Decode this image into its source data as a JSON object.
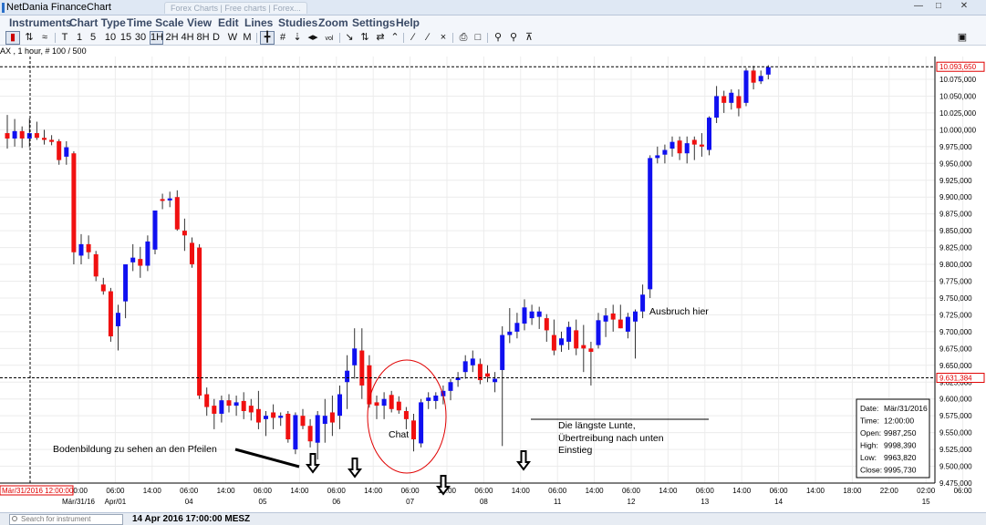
{
  "window": {
    "title": "NetDania FinanceChart",
    "background_tab": "Forex Charts | Free charts | Forex..."
  },
  "menu": [
    "Instruments",
    "Chart Type",
    "Time Scale",
    "View",
    "Edit",
    "Lines",
    "Studies",
    "Zoom",
    "Settings",
    "Help"
  ],
  "toolbar": {
    "timescales": [
      "T",
      "1",
      "5",
      "10",
      "15",
      "30",
      "1H",
      "2H",
      "4H",
      "8H",
      "D",
      "W",
      "M"
    ],
    "selected_timescale": "1H"
  },
  "instrument_info": "AX , 1 hour, # 100 / 500",
  "price_tags": {
    "upper": "10.093,650",
    "lower": "9.631,384"
  },
  "cursor_date_tag": "Mär/31/2016 12:00:00",
  "data_box": {
    "rows": [
      {
        "label": "Date:",
        "value": "Mär/31/2016"
      },
      {
        "label": "Time:",
        "value": "12:00:00"
      },
      {
        "label": "Open:",
        "value": "9987,250"
      },
      {
        "label": "High:",
        "value": "9998,390"
      },
      {
        "label": "Low:",
        "value": "9963,820"
      },
      {
        "label": "Close:",
        "value": "9995,730"
      }
    ]
  },
  "annotations": {
    "bodenbildung": "Bodenbildung zu sehen an den Pfeilen",
    "chat": "Chat",
    "lunte_line1": "Die längste Lunte,",
    "lunte_line2": "Übertreibung nach unten",
    "lunte_line3": "Einstieg",
    "ausbruch": "Ausbruch hier"
  },
  "status": {
    "search_placeholder": "Search for instrument",
    "datetime": "14 Apr 2016 17:00:00 MESZ"
  },
  "chart_data": {
    "type": "candlestick",
    "y_ticks": [
      "10.075,000",
      "10.050,000",
      "10.025,000",
      "10.000,000",
      "9.975,000",
      "9.950,000",
      "9.925,000",
      "9.900,000",
      "9.875,000",
      "9.850,000",
      "9.825,000",
      "9.800,000",
      "9.775,000",
      "9.750,000",
      "9.725,000",
      "9.700,000",
      "9.675,000",
      "9.650,000",
      "9.625,000",
      "9.600,000",
      "9.575,000",
      "9.550,000",
      "9.525,000",
      "9.500,000",
      "9.475,000"
    ],
    "y_tick_values": [
      10075,
      10050,
      10025,
      10000,
      9975,
      9950,
      9925,
      9900,
      9875,
      9850,
      9825,
      9800,
      9775,
      9750,
      9725,
      9700,
      9675,
      9650,
      9625,
      9600,
      9575,
      9550,
      9525,
      9500,
      9475
    ],
    "x_ticks": [
      {
        "time": "00:00",
        "date": "Mär/31/16"
      },
      {
        "time": "06:00",
        "date": "Apr/01"
      },
      {
        "time": "14:00",
        "date": ""
      },
      {
        "time": "06:00",
        "date": "04"
      },
      {
        "time": "14:00",
        "date": ""
      },
      {
        "time": "06:00",
        "date": "05"
      },
      {
        "time": "14:00",
        "date": ""
      },
      {
        "time": "06:00",
        "date": "06"
      },
      {
        "time": "14:00",
        "date": ""
      },
      {
        "time": "06:00",
        "date": "07"
      },
      {
        "time": "14:00",
        "date": ""
      },
      {
        "time": "06:00",
        "date": "08"
      },
      {
        "time": "14:00",
        "date": ""
      },
      {
        "time": "06:00",
        "date": "11"
      },
      {
        "time": "14:00",
        "date": ""
      },
      {
        "time": "06:00",
        "date": "12"
      },
      {
        "time": "14:00",
        "date": ""
      },
      {
        "time": "06:00",
        "date": "13"
      },
      {
        "time": "14:00",
        "date": ""
      },
      {
        "time": "06:00",
        "date": "14"
      },
      {
        "time": "14:00",
        "date": ""
      },
      {
        "time": "18:00",
        "date": ""
      },
      {
        "time": "22:00",
        "date": ""
      },
      {
        "time": "02:00",
        "date": "15"
      },
      {
        "time": "06:00",
        "date": ""
      }
    ],
    "candles": [
      {
        "o": 9995,
        "h": 10022,
        "l": 9972,
        "c": 9987
      },
      {
        "o": 9987,
        "h": 10016,
        "l": 9975,
        "c": 9998
      },
      {
        "o": 9998,
        "h": 10005,
        "l": 9973,
        "c": 9987
      },
      {
        "o": 9987,
        "h": 10017,
        "l": 9974,
        "c": 9995
      },
      {
        "o": 9995,
        "h": 10012,
        "l": 9985,
        "c": 9988
      },
      {
        "o": 9988,
        "h": 10000,
        "l": 9978,
        "c": 9985
      },
      {
        "o": 9985,
        "h": 9992,
        "l": 9977,
        "c": 9982
      },
      {
        "o": 9983,
        "h": 9986,
        "l": 9948,
        "c": 9955
      },
      {
        "o": 9960,
        "h": 9983,
        "l": 9948,
        "c": 9974
      },
      {
        "o": 9965,
        "h": 9968,
        "l": 9800,
        "c": 9818
      },
      {
        "o": 9813,
        "h": 9845,
        "l": 9800,
        "c": 9830
      },
      {
        "o": 9830,
        "h": 9843,
        "l": 9808,
        "c": 9818
      },
      {
        "o": 9815,
        "h": 9820,
        "l": 9775,
        "c": 9782
      },
      {
        "o": 9770,
        "h": 9780,
        "l": 9755,
        "c": 9760
      },
      {
        "o": 9760,
        "h": 9765,
        "l": 9685,
        "c": 9693
      },
      {
        "o": 9708,
        "h": 9740,
        "l": 9672,
        "c": 9728
      },
      {
        "o": 9745,
        "h": 9800,
        "l": 9720,
        "c": 9800
      },
      {
        "o": 9803,
        "h": 9830,
        "l": 9790,
        "c": 9810
      },
      {
        "o": 9808,
        "h": 9826,
        "l": 9780,
        "c": 9798
      },
      {
        "o": 9798,
        "h": 9843,
        "l": 9790,
        "c": 9834
      },
      {
        "o": 9822,
        "h": 9878,
        "l": 9815,
        "c": 9880
      },
      {
        "o": 9897,
        "h": 9905,
        "l": 9882,
        "c": 9895
      },
      {
        "o": 9895,
        "h": 9908,
        "l": 9885,
        "c": 9898
      },
      {
        "o": 9900,
        "h": 9910,
        "l": 9850,
        "c": 9852
      },
      {
        "o": 9850,
        "h": 9868,
        "l": 9820,
        "c": 9843
      },
      {
        "o": 9832,
        "h": 9840,
        "l": 9795,
        "c": 9800
      },
      {
        "o": 9825,
        "h": 9830,
        "l": 9600,
        "c": 9605
      },
      {
        "o": 9607,
        "h": 9617,
        "l": 9575,
        "c": 9588
      },
      {
        "o": 9590,
        "h": 9600,
        "l": 9555,
        "c": 9578
      },
      {
        "o": 9578,
        "h": 9605,
        "l": 9565,
        "c": 9598
      },
      {
        "o": 9598,
        "h": 9607,
        "l": 9580,
        "c": 9590
      },
      {
        "o": 9590,
        "h": 9605,
        "l": 9575,
        "c": 9595
      },
      {
        "o": 9597,
        "h": 9610,
        "l": 9570,
        "c": 9582
      },
      {
        "o": 9590,
        "h": 9600,
        "l": 9568,
        "c": 9580
      },
      {
        "o": 9585,
        "h": 9612,
        "l": 9555,
        "c": 9565
      },
      {
        "o": 9570,
        "h": 9582,
        "l": 9545,
        "c": 9575
      },
      {
        "o": 9580,
        "h": 9592,
        "l": 9555,
        "c": 9572
      },
      {
        "o": 9572,
        "h": 9580,
        "l": 9560,
        "c": 9575
      },
      {
        "o": 9578,
        "h": 9582,
        "l": 9535,
        "c": 9540
      },
      {
        "o": 9525,
        "h": 9580,
        "l": 9518,
        "c": 9576
      },
      {
        "o": 9575,
        "h": 9585,
        "l": 9555,
        "c": 9560
      },
      {
        "o": 9560,
        "h": 9570,
        "l": 9528,
        "c": 9537
      },
      {
        "o": 9535,
        "h": 9582,
        "l": 9510,
        "c": 9576
      },
      {
        "o": 9563,
        "h": 9600,
        "l": 9535,
        "c": 9575
      },
      {
        "o": 9580,
        "h": 9605,
        "l": 9545,
        "c": 9565
      },
      {
        "o": 9575,
        "h": 9620,
        "l": 9555,
        "c": 9607
      },
      {
        "o": 9625,
        "h": 9665,
        "l": 9585,
        "c": 9642
      },
      {
        "o": 9650,
        "h": 9705,
        "l": 9630,
        "c": 9675
      },
      {
        "o": 9672,
        "h": 9705,
        "l": 9600,
        "c": 9620
      },
      {
        "o": 9650,
        "h": 9665,
        "l": 9587,
        "c": 9592
      },
      {
        "o": 9595,
        "h": 9605,
        "l": 9570,
        "c": 9590
      },
      {
        "o": 9590,
        "h": 9610,
        "l": 9570,
        "c": 9600
      },
      {
        "o": 9606,
        "h": 9612,
        "l": 9580,
        "c": 9585
      },
      {
        "o": 9596,
        "h": 9604,
        "l": 9578,
        "c": 9583
      },
      {
        "o": 9582,
        "h": 9588,
        "l": 9555,
        "c": 9570
      },
      {
        "o": 9568,
        "h": 9578,
        "l": 9522,
        "c": 9540
      },
      {
        "o": 9534,
        "h": 9600,
        "l": 9528,
        "c": 9595
      },
      {
        "o": 9597,
        "h": 9610,
        "l": 9585,
        "c": 9602
      },
      {
        "o": 9597,
        "h": 9610,
        "l": 9585,
        "c": 9605
      },
      {
        "o": 9604,
        "h": 9620,
        "l": 9592,
        "c": 9612
      },
      {
        "o": 9612,
        "h": 9630,
        "l": 9598,
        "c": 9625
      },
      {
        "o": 9628,
        "h": 9640,
        "l": 9618,
        "c": 9632
      },
      {
        "o": 9640,
        "h": 9665,
        "l": 9630,
        "c": 9656
      },
      {
        "o": 9650,
        "h": 9672,
        "l": 9640,
        "c": 9660
      },
      {
        "o": 9652,
        "h": 9660,
        "l": 9622,
        "c": 9628
      },
      {
        "o": 9638,
        "h": 9650,
        "l": 9625,
        "c": 9633
      },
      {
        "o": 9625,
        "h": 9640,
        "l": 9610,
        "c": 9630
      },
      {
        "o": 9643,
        "h": 9708,
        "l": 9530,
        "c": 9695
      },
      {
        "o": 9695,
        "h": 9735,
        "l": 9683,
        "c": 9700
      },
      {
        "o": 9700,
        "h": 9728,
        "l": 9690,
        "c": 9713
      },
      {
        "o": 9712,
        "h": 9748,
        "l": 9702,
        "c": 9736
      },
      {
        "o": 9720,
        "h": 9740,
        "l": 9710,
        "c": 9730
      },
      {
        "o": 9722,
        "h": 9737,
        "l": 9704,
        "c": 9730
      },
      {
        "o": 9720,
        "h": 9726,
        "l": 9685,
        "c": 9702
      },
      {
        "o": 9695,
        "h": 9718,
        "l": 9665,
        "c": 9672
      },
      {
        "o": 9680,
        "h": 9700,
        "l": 9670,
        "c": 9690
      },
      {
        "o": 9685,
        "h": 9715,
        "l": 9673,
        "c": 9707
      },
      {
        "o": 9702,
        "h": 9718,
        "l": 9665,
        "c": 9675
      },
      {
        "o": 9680,
        "h": 9710,
        "l": 9640,
        "c": 9675
      },
      {
        "o": 9675,
        "h": 9685,
        "l": 9620,
        "c": 9670
      },
      {
        "o": 9680,
        "h": 9728,
        "l": 9675,
        "c": 9717
      },
      {
        "o": 9715,
        "h": 9735,
        "l": 9692,
        "c": 9724
      },
      {
        "o": 9727,
        "h": 9740,
        "l": 9700,
        "c": 9718
      },
      {
        "o": 9718,
        "h": 9740,
        "l": 9705,
        "c": 9705
      },
      {
        "o": 9700,
        "h": 9728,
        "l": 9690,
        "c": 9722
      },
      {
        "o": 9715,
        "h": 9733,
        "l": 9660,
        "c": 9730
      },
      {
        "o": 9730,
        "h": 9770,
        "l": 9720,
        "c": 9755
      },
      {
        "o": 9763,
        "h": 9962,
        "l": 9750,
        "c": 9958
      },
      {
        "o": 9958,
        "h": 9975,
        "l": 9950,
        "c": 9962
      },
      {
        "o": 9963,
        "h": 9978,
        "l": 9950,
        "c": 9970
      },
      {
        "o": 9972,
        "h": 9990,
        "l": 9960,
        "c": 9982
      },
      {
        "o": 9984,
        "h": 9990,
        "l": 9955,
        "c": 9965
      },
      {
        "o": 9965,
        "h": 9990,
        "l": 9950,
        "c": 9980
      },
      {
        "o": 9985,
        "h": 9990,
        "l": 9955,
        "c": 9978
      },
      {
        "o": 9978,
        "h": 9995,
        "l": 9960,
        "c": 9975
      },
      {
        "o": 9970,
        "h": 10020,
        "l": 9962,
        "c": 10018
      },
      {
        "o": 10018,
        "h": 10065,
        "l": 10010,
        "c": 10050
      },
      {
        "o": 10050,
        "h": 10058,
        "l": 10025,
        "c": 10040
      },
      {
        "o": 10040,
        "h": 10060,
        "l": 10030,
        "c": 10055
      },
      {
        "o": 10050,
        "h": 10060,
        "l": 10020,
        "c": 10032
      },
      {
        "o": 10040,
        "h": 10092,
        "l": 10035,
        "c": 10088
      },
      {
        "o": 10088,
        "h": 10095,
        "l": 10060,
        "c": 10070
      },
      {
        "o": 10072,
        "h": 10088,
        "l": 10068,
        "c": 10080
      },
      {
        "o": 10082,
        "h": 10096,
        "l": 10075,
        "c": 10093
      }
    ]
  }
}
